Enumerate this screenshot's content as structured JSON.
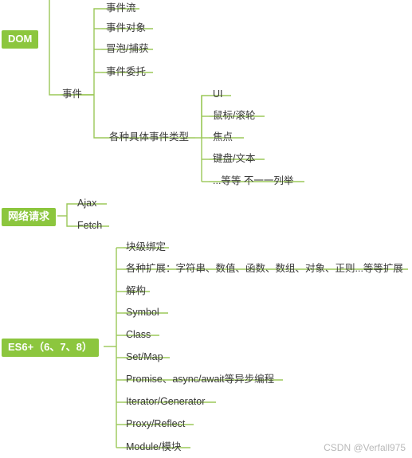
{
  "diagram": {
    "type": "mindmap",
    "accent_color": "#8cc63e",
    "line_color": "#9bc858",
    "text_color": "#3a3a3a",
    "roots": [
      {
        "id": "dom",
        "label": "DOM",
        "children": [
          {
            "id": "events",
            "label": "事件",
            "children": [
              {
                "id": "event-flow",
                "label": "事件流"
              },
              {
                "id": "event-object",
                "label": "事件对象"
              },
              {
                "id": "bubble-capture",
                "label": "冒泡/捕获"
              },
              {
                "id": "event-delegate",
                "label": "事件委托"
              },
              {
                "id": "concrete-event-types",
                "label": "各种具体事件类型",
                "children": [
                  {
                    "id": "ui",
                    "label": "UI"
                  },
                  {
                    "id": "mouse-wheel",
                    "label": "鼠标/滚轮"
                  },
                  {
                    "id": "focus",
                    "label": "焦点"
                  },
                  {
                    "id": "keyboard-text",
                    "label": "键盘/文本"
                  },
                  {
                    "id": "etc",
                    "label": "...等等 不一一列举"
                  }
                ]
              }
            ]
          }
        ]
      },
      {
        "id": "network",
        "label": "网络请求",
        "children": [
          {
            "id": "ajax",
            "label": "Ajax"
          },
          {
            "id": "fetch",
            "label": "Fetch"
          }
        ]
      },
      {
        "id": "es6",
        "label": "ES6+（6、7、8）",
        "children": [
          {
            "id": "block-binding",
            "label": "块级绑定"
          },
          {
            "id": "extensions",
            "label": "各种扩展：字符串、数值、函数、数组、对象、正则...等等扩展"
          },
          {
            "id": "destructuring",
            "label": "解构"
          },
          {
            "id": "symbol",
            "label": "Symbol"
          },
          {
            "id": "class",
            "label": "Class"
          },
          {
            "id": "set-map",
            "label": "Set/Map"
          },
          {
            "id": "promise-async",
            "label": "Promise、async/await等异步编程"
          },
          {
            "id": "iterator-generator",
            "label": "Iterator/Generator"
          },
          {
            "id": "proxy-reflect",
            "label": "Proxy/Reflect"
          },
          {
            "id": "module",
            "label": "Module/模块"
          }
        ]
      }
    ],
    "watermark": "CSDN @Verfall975"
  }
}
